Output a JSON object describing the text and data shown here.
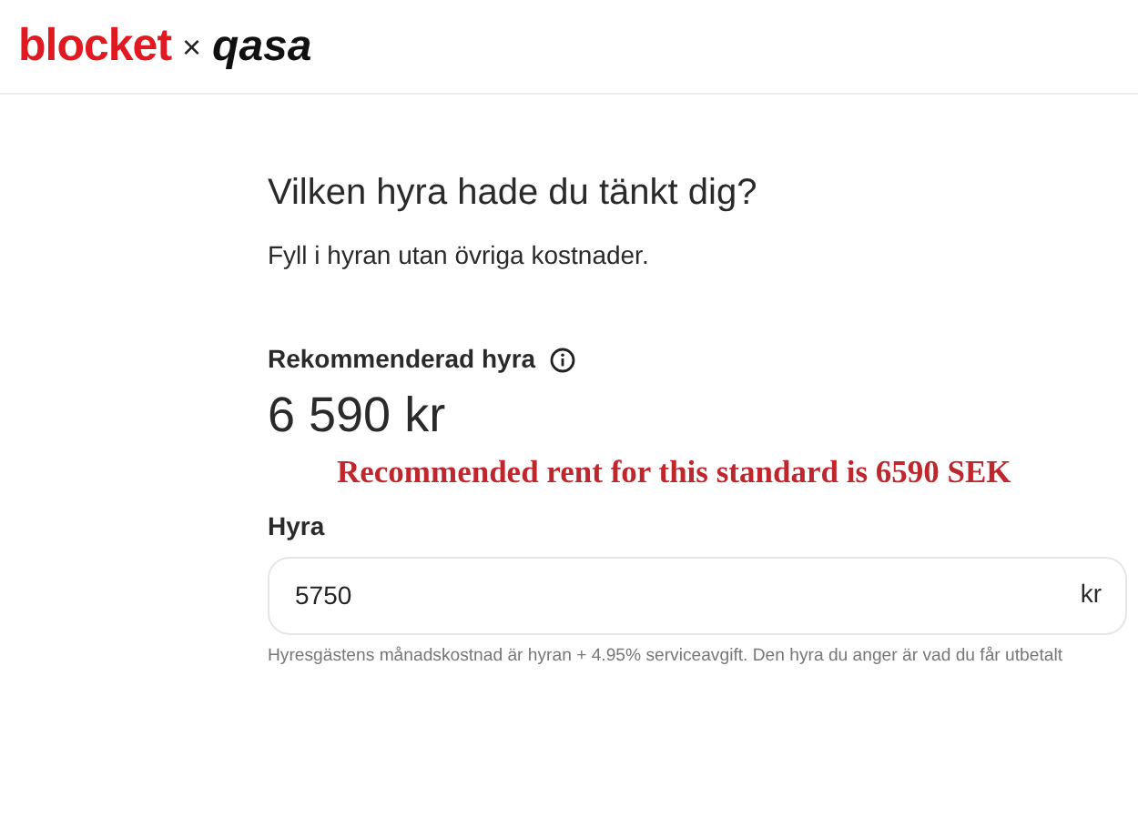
{
  "header": {
    "logo_left": "blocket",
    "separator": "×",
    "logo_right": "qasa"
  },
  "heading": "Vilken hyra hade du tänkt dig?",
  "subtitle": "Fyll i hyran utan övriga kostnader.",
  "recommended": {
    "label": "Rekommenderad hyra",
    "value": "6 590 kr"
  },
  "annotation": "Recommended rent for this standard is 6590 SEK",
  "rent_field": {
    "label": "Hyra",
    "value": "5750",
    "unit": "kr"
  },
  "helper_text": "Hyresgästens månadskostnad är hyran + 4.95% serviceavgift. Den hyra du anger är vad du får utbetalt"
}
